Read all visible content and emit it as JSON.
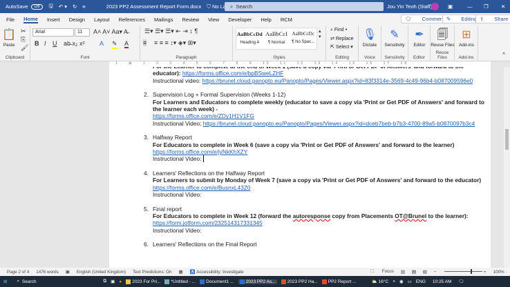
{
  "titlebar": {
    "autosave": "AutoSave",
    "autosave_state": "Off",
    "doc_title": "2023 PP2 Assessment Report Form.docx",
    "label": "No Label",
    "search": "Search",
    "user": "Jou Yin Teoh (Staff)",
    "avatar_initial": "JY"
  },
  "tabs": [
    "File",
    "Home",
    "Insert",
    "Design",
    "Layout",
    "References",
    "Mailings",
    "Review",
    "View",
    "Developer",
    "Help",
    "RCM"
  ],
  "tab_buttons": {
    "comments": "Comments",
    "editing": "Editing",
    "share": "Share"
  },
  "ribbon": {
    "clipboard": {
      "paste": "Paste",
      "label": "Clipboard"
    },
    "font": {
      "name": "Arial",
      "size": "11",
      "label": "Font"
    },
    "paragraph": {
      "label": "Paragraph"
    },
    "styles": {
      "items": [
        {
          "preview": "AaBbCcDd",
          "name": "Heading 4"
        },
        {
          "preview": "AaBbCcI",
          "name": "¶ Normal"
        },
        {
          "preview": "AaBbCcDc",
          "name": "¶ No Spac..."
        }
      ],
      "label": "Styles"
    },
    "editing": {
      "find": "Find",
      "replace": "Replace",
      "select": "Select",
      "label": "Editing"
    },
    "voice": {
      "dictate": "Dictate",
      "label": "Voice"
    },
    "sensitivity": {
      "button": "Sensitivity",
      "label": "Sensitivity"
    },
    "editor": {
      "button": "Editor",
      "label": "Editor"
    },
    "reuse": {
      "button": "Reuse Files",
      "label": "Reuse Files"
    },
    "addins": {
      "button": "Add-ins",
      "label": "Add-ins"
    }
  },
  "ruler": "· 1 · ⊠ · 1 · 2 · 3 · 4 · 5 · 6 · 7 · 8 · 9 · 10 · 11 · 12 · 13 · 14 · 15 · 16 · 17 · 18",
  "document": {
    "top": {
      "bold": "For the Learner to complete at the end of Week 1 (save a copy via 'Print or Get PDF of Answers' and forward to the educator):",
      "link": "https://forms.office.com/e/bpBSweLZHF",
      "video_label": "Instructional video:",
      "video_link": "https://brunel.cloud.panopto.eu/Panopto/Pages/Viewer.aspx?id=83f3314e-3569-4c49-96b4-b087009596e0"
    },
    "items": [
      {
        "num": "2.",
        "title": "Supervision Log + Formal Supervision (Weeks 1-12)",
        "bold": "For Learners and Educators to complete weekly (educator to save a copy via 'Print or Get PDF of Answers' and forward to the learner each week) -",
        "link": "https://forms.office.com/e/ZDy1H1V1FG",
        "video_label": "Instructional Video:",
        "video_link": "https://brunel.cloud.panopto.eu/Panopto/Pages/Viewer.aspx?id=dceb7beb-b7b3-4700-89a5-b0870097b3c4"
      },
      {
        "num": "3.",
        "title": "Halfway Report",
        "bold": "For Educators to complete in Week 6 (save a copy via 'Print or Get PDF of Answers' and forward to the learner)",
        "link": "https://forms.office.com/e/jyNkKhXZY",
        "video_label": "Instructional Video:",
        "video_link": ""
      },
      {
        "num": "4.",
        "title": "Learners' Reflections on the Halfway Report",
        "bold": "For Learners to submit by Monday of Week 7 (save a copy via 'Print or Get PDF of Answers' and forward to the educator)",
        "link": "https://forms.office.com/e/BusnxL43Z0",
        "video_label": "Instructional Video:",
        "video_link": ""
      }
    ],
    "item5": {
      "num": "5.",
      "title": "Final report",
      "bold_a": "For Educators to complete in Week 12 (forward the ",
      "bold_sq": "autoresponse",
      "bold_b": " copy from Placements ",
      "bold_sq2": "OT@Brunel",
      "bold_c": " to the learner):",
      "link": "https://form.jotform.com/232514317331345",
      "video_label": "Instructional Video:"
    },
    "item6": {
      "num": "6.",
      "title": "Learners' Reflections on the Final Report"
    }
  },
  "status": {
    "page": "Page 2 of 4",
    "words": "1476 words",
    "language": "English (United Kingdom)",
    "predictions": "Text Predictions: On",
    "accessibility": "Accessibility: Investigate",
    "focus": "Focus",
    "zoom": "100%",
    "zoom_level": 100
  },
  "taskbar": {
    "search": "Search",
    "apps": [
      "2023 For Pri...",
      "*Untitled - ...",
      "Document1 ...",
      "2023 PP2 As...",
      "2023 PP2 Ha...",
      "PP2 Report ..."
    ],
    "weather": "16°C",
    "lang": "ENG",
    "time": "10:25 AM"
  }
}
